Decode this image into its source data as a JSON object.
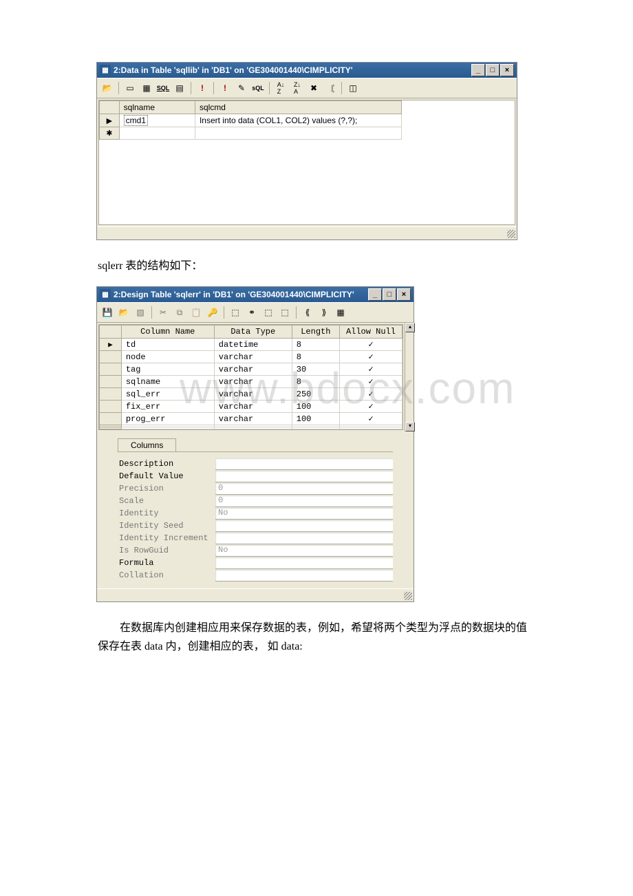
{
  "watermark": "www.bdocx.com",
  "window1": {
    "title": "2:Data in Table 'sqllib' in 'DB1' on 'GE304001440\\CIMPLICITY'",
    "headers": [
      "sqlname",
      "sqlcmd"
    ],
    "rows": [
      {
        "sqlname": "cmd1",
        "sqlcmd": "Insert into data (COL1, COL2) values (?,?);"
      }
    ]
  },
  "para1": "sqlerr 表的结构如下：",
  "window2": {
    "title": "2:Design Table 'sqlerr' in 'DB1' on 'GE304001440\\CIMPLICITY'",
    "headers": [
      "Column Name",
      "Data Type",
      "Length",
      "Allow Null"
    ],
    "rows": [
      {
        "name": "td",
        "type": "datetime",
        "len": "8",
        "null": true
      },
      {
        "name": "node",
        "type": "varchar",
        "len": "8",
        "null": true
      },
      {
        "name": "tag",
        "type": "varchar",
        "len": "30",
        "null": true
      },
      {
        "name": "sqlname",
        "type": "varchar",
        "len": "8",
        "null": true
      },
      {
        "name": "sql_err",
        "type": "varchar",
        "len": "250",
        "null": true
      },
      {
        "name": "fix_err",
        "type": "varchar",
        "len": "100",
        "null": true
      },
      {
        "name": "prog_err",
        "type": "varchar",
        "len": "100",
        "null": true
      }
    ],
    "tab": "Columns",
    "props": [
      {
        "label": "Description",
        "value": "",
        "dim": false
      },
      {
        "label": "Default Value",
        "value": "",
        "dim": false
      },
      {
        "label": "Precision",
        "value": "0",
        "dim": true
      },
      {
        "label": "Scale",
        "value": "0",
        "dim": true
      },
      {
        "label": "Identity",
        "value": "No",
        "dim": true
      },
      {
        "label": "Identity Seed",
        "value": "",
        "dim": true
      },
      {
        "label": "Identity Increment",
        "value": "",
        "dim": true
      },
      {
        "label": "Is RowGuid",
        "value": "No",
        "dim": true
      },
      {
        "label": "Formula",
        "value": "",
        "dim": false
      },
      {
        "label": "Collation",
        "value": "",
        "dim": true
      }
    ]
  },
  "para2": "　　在数据库内创建相应用来保存数据的表，例如，希望将两个类型为浮点的数据块的值保存在表 data 内，创建相应的表， 如 data:"
}
